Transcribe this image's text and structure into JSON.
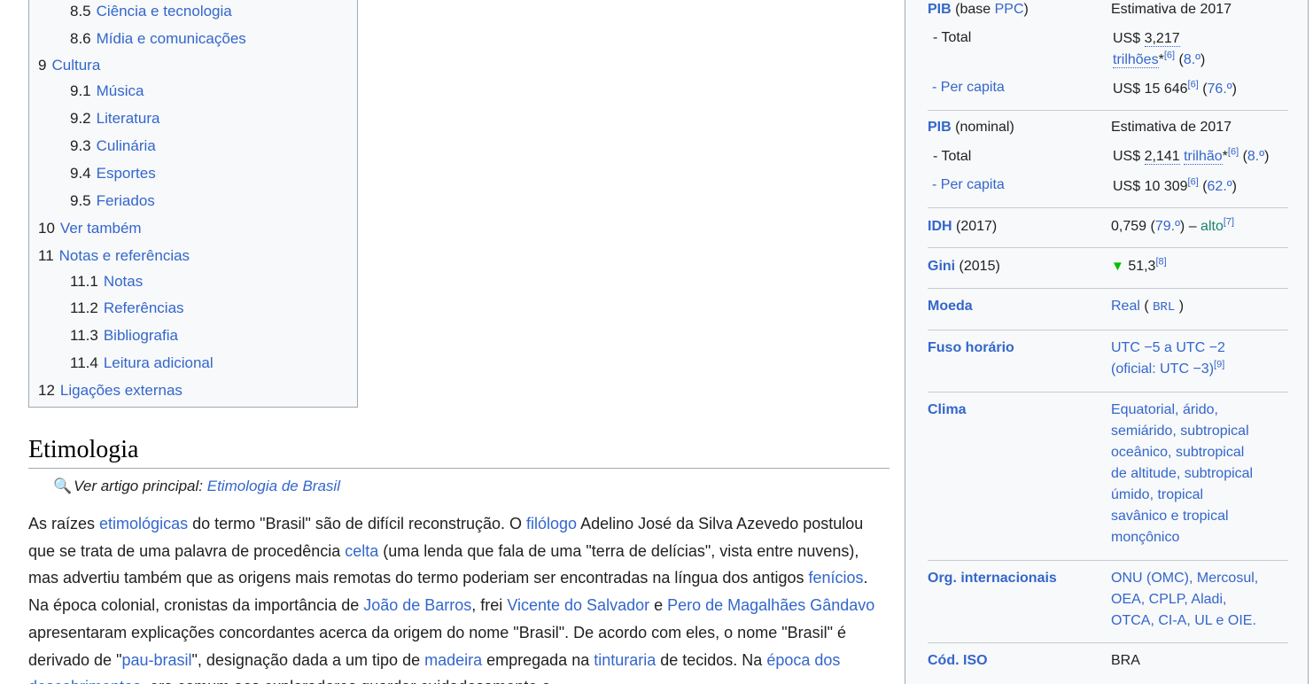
{
  "toc": {
    "items": [
      {
        "num": "8.5",
        "label": "Ciência e tecnologia",
        "level": 2
      },
      {
        "num": "8.6",
        "label": "Mídia e comunicações",
        "level": 2
      },
      {
        "num": "9",
        "label": "Cultura",
        "level": 1
      },
      {
        "num": "9.1",
        "label": "Música",
        "level": 2
      },
      {
        "num": "9.2",
        "label": "Literatura",
        "level": 2
      },
      {
        "num": "9.3",
        "label": "Culinária",
        "level": 2
      },
      {
        "num": "9.4",
        "label": "Esportes",
        "level": 2
      },
      {
        "num": "9.5",
        "label": "Feriados",
        "level": 2
      },
      {
        "num": "10",
        "label": "Ver também",
        "level": 1
      },
      {
        "num": "11",
        "label": "Notas e referências",
        "level": 1
      },
      {
        "num": "11.1",
        "label": "Notas",
        "level": 2
      },
      {
        "num": "11.2",
        "label": "Referências",
        "level": 2
      },
      {
        "num": "11.3",
        "label": "Bibliografia",
        "level": 2
      },
      {
        "num": "11.4",
        "label": "Leitura adicional",
        "level": 2
      },
      {
        "num": "12",
        "label": "Ligações externas",
        "level": 1
      }
    ]
  },
  "section": {
    "title": "Etimologia",
    "hatnote_prefix": "Ver artigo principal: ",
    "hatnote_link": "Etimologia de Brasil",
    "paragraph": [
      {
        "t": "As raízes "
      },
      {
        "t": "etimológicas",
        "link": true
      },
      {
        "t": " do termo \"Brasil\" são de difícil reconstrução. O "
      },
      {
        "t": "filólogo",
        "link": true
      },
      {
        "t": " Adelino José da Silva Azevedo postulou que se trata de uma palavra de procedência "
      },
      {
        "t": "celta",
        "link": true
      },
      {
        "t": " (uma lenda que fala de uma \"terra de delícias\", vista entre nuvens), mas advertiu também que as origens mais remotas do termo poderiam ser encontradas na língua dos antigos "
      },
      {
        "t": "fenícios",
        "link": true
      },
      {
        "t": ". Na época colonial, cronistas da importância de "
      },
      {
        "t": "João de Barros",
        "link": true
      },
      {
        "t": ", frei "
      },
      {
        "t": "Vicente do Salvador",
        "link": true
      },
      {
        "t": " e "
      },
      {
        "t": "Pero de Magalhães Gândavo",
        "link": true
      },
      {
        "t": " apresentaram explicações concordantes acerca da origem do nome \"Brasil\". De acordo com eles, o nome \"Brasil\" é derivado de \""
      },
      {
        "t": "pau-brasil",
        "link": true
      },
      {
        "t": "\", designação dada a um tipo de "
      },
      {
        "t": "madeira",
        "link": true
      },
      {
        "t": " empregada na "
      },
      {
        "t": "tinturaria",
        "link": true
      },
      {
        "t": " de tecidos. Na "
      },
      {
        "t": "época dos descobrimentos",
        "link": true
      },
      {
        "t": ", era comum aos exploradores guardar cuidadosamente o"
      }
    ]
  },
  "infobox": {
    "pib_ppc": {
      "label": "PIB",
      "label_rest": " (base ",
      "label_link": "PPC",
      "label_end": ")",
      "year": "Estimativa de 2017",
      "total_label": "- Total",
      "total_prefix": "US$ ",
      "total_value": "3,217",
      "total_unit": "trilhões",
      "total_star": "*",
      "total_ref": "[6]",
      "total_rank": "8.º",
      "pc_label": "- Per capita",
      "pc_value": "US$ 15 646",
      "pc_ref": "[6]",
      "pc_rank": "76.º"
    },
    "pib_nom": {
      "label": "PIB",
      "label_rest": " (nominal)",
      "year": "Estimativa de 2017",
      "total_label": "- Total",
      "total_prefix": "US$ ",
      "total_value": "2,141",
      "total_unit": "trilhão",
      "total_star": "*",
      "total_ref": "[6]",
      "total_rank": "8.º",
      "pc_label": "- Per capita",
      "pc_value": "US$ 10 309",
      "pc_ref": "[6]",
      "pc_rank": "62.º"
    },
    "idh": {
      "label": "IDH",
      "label_rest": " (2017)",
      "value": "0,759",
      "rank": "79.º",
      "dash": " – ",
      "level": "alto",
      "ref": "[7]"
    },
    "gini": {
      "label": "Gini",
      "label_rest": " (2015)",
      "arrow": "▼",
      "value": "51,3",
      "ref": "[8]"
    },
    "moeda": {
      "label": "Moeda",
      "value": "Real",
      "code": "BRL"
    },
    "fuso": {
      "label": "Fuso horário",
      "line1": "UTC −5 a UTC −2",
      "line2": "(oficial: UTC −3)",
      "ref": "[9]"
    },
    "clima": {
      "label": "Clima",
      "lines": [
        "Equatorial, árido,",
        "semiárido, subtropical",
        "oceânico, subtropical",
        "de altitude, subtropical",
        "úmido, tropical",
        "savânico e tropical",
        "monçônico"
      ]
    },
    "org": {
      "label": "Org. internacionais",
      "lines": [
        "ONU (OMC), Mercosul,",
        "OEA, CPLP, Aladi,",
        "OTCA, CI-A, UL e OIE."
      ]
    },
    "iso": {
      "label": "Cód. ISO",
      "value": "BRA"
    }
  }
}
